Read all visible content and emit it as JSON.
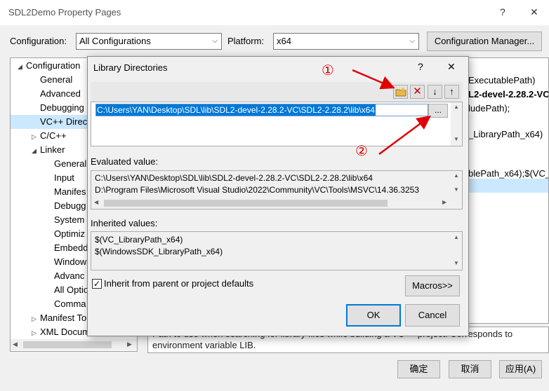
{
  "window": {
    "title": "SDL2Demo Property Pages",
    "help_glyph": "?",
    "close_glyph": "✕"
  },
  "config_bar": {
    "configuration_label": "Configuration:",
    "configuration_value": "All Configurations",
    "platform_label": "Platform:",
    "platform_value": "x64",
    "config_manager_label": "Configuration Manager..."
  },
  "tree": {
    "items": [
      {
        "label": "Configuration",
        "exp": "◢"
      },
      {
        "label": "General",
        "exp": ""
      },
      {
        "label": "Advanced",
        "exp": ""
      },
      {
        "label": "Debugging",
        "exp": ""
      },
      {
        "label": "VC++ Direc",
        "exp": ""
      },
      {
        "label": "C/C++",
        "exp": "▷"
      },
      {
        "label": "Linker",
        "exp": "◢"
      },
      {
        "label": "General",
        "exp": ""
      },
      {
        "label": "Input",
        "exp": ""
      },
      {
        "label": "Manifes",
        "exp": ""
      },
      {
        "label": "Debugg",
        "exp": ""
      },
      {
        "label": "System",
        "exp": ""
      },
      {
        "label": "Optimiz",
        "exp": ""
      },
      {
        "label": "Embedd",
        "exp": ""
      },
      {
        "label": "Window",
        "exp": ""
      },
      {
        "label": "Advanc",
        "exp": ""
      },
      {
        "label": "All Optio",
        "exp": ""
      },
      {
        "label": "Comma",
        "exp": ""
      },
      {
        "label": "Manifest To",
        "exp": "▷"
      },
      {
        "label": "XML Docume",
        "exp": "▷"
      }
    ]
  },
  "right_pane": {
    "lines": [
      "ExecutablePath)",
      "L2-devel-2.28.2-VC",
      "ludePath);",
      "_LibraryPath_x64)",
      "blePath_x64);$(VC_L"
    ],
    "description": "Path to use when searching for library files while building a VC++ project.  Corresponds to environment variable LIB."
  },
  "footer": {
    "ok_label": "确定",
    "cancel_label": "取消",
    "apply_label": "应用(A)"
  },
  "dialog": {
    "title": "Library Directories",
    "help_glyph": "?",
    "close_glyph": "✕",
    "toolbar": {
      "new_folder_icon": "folder-new-icon",
      "delete_glyph": "✕",
      "down_glyph": "↓",
      "up_glyph": "↑"
    },
    "entry_path": "C:\\Users\\YAN\\Desktop\\SDL\\lib\\SDL2-devel-2.28.2-VC\\SDL2-2.28.2\\lib\\x64",
    "browse_label": "...",
    "evaluated_label": "Evaluated value:",
    "evaluated_lines": [
      "C:\\Users\\YAN\\Desktop\\SDL\\lib\\SDL2-devel-2.28.2-VC\\SDL2-2.28.2\\lib\\x64",
      "D:\\Program Files\\Microsoft Visual Studio\\2022\\Community\\VC\\Tools\\MSVC\\14.36.3253"
    ],
    "inherited_label": "Inherited values:",
    "inherited_lines": [
      "$(VC_LibraryPath_x64)",
      "$(WindowsSDK_LibraryPath_x64)"
    ],
    "inherit_checkbox_label": "Inherit from parent or project defaults",
    "inherit_checked": true,
    "macros_label": "Macros>>",
    "ok_label": "OK",
    "cancel_label": "Cancel"
  },
  "annotations": {
    "marker_1": "①",
    "marker_2": "②",
    "color": "#e00000"
  }
}
